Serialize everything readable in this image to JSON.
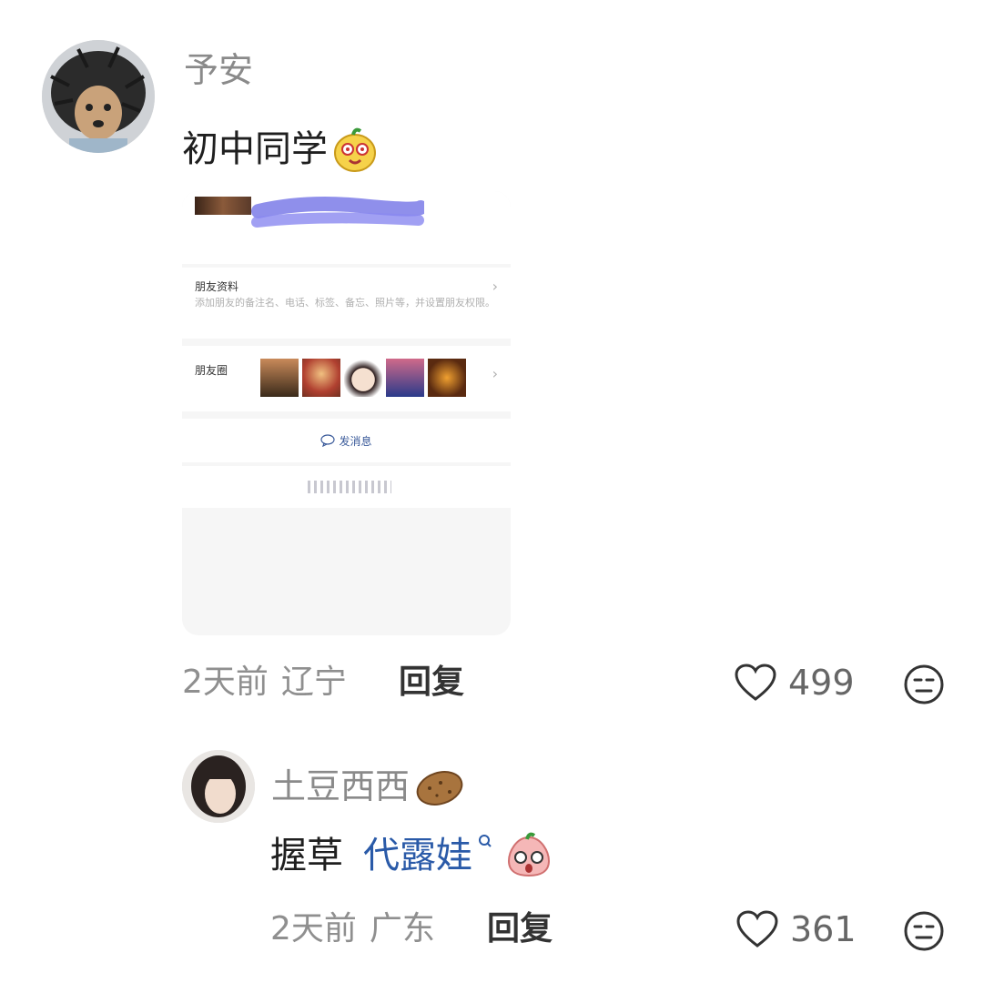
{
  "comments": [
    {
      "username": "予安",
      "text": "初中同学",
      "time": "2天前",
      "location": "辽宁",
      "reply_label": "回复",
      "likes": "499",
      "screenshot": {
        "section1_title": "朋友资料",
        "section1_desc": "添加朋友的备注名、电话、标签、备忘、照片等，并设置朋友权限。",
        "section2_title": "朋友圈",
        "send_message": "发消息",
        "chevron": "›"
      }
    },
    {
      "username": "土豆西西",
      "text": "握草",
      "link_text": "代露娃",
      "link_suffix": "ᵠ",
      "time": "2天前",
      "location": "广东",
      "reply_label": "回复",
      "likes": "361"
    }
  ],
  "colors": {
    "name": "#8a8a8a",
    "link": "#2a5aa8",
    "meta": "#8f8f8f"
  },
  "icons": [
    "heart-icon",
    "dislike-face-icon",
    "emoji-face-icon",
    "potato-emoji-icon",
    "search-icon",
    "chat-bubble-icon"
  ]
}
